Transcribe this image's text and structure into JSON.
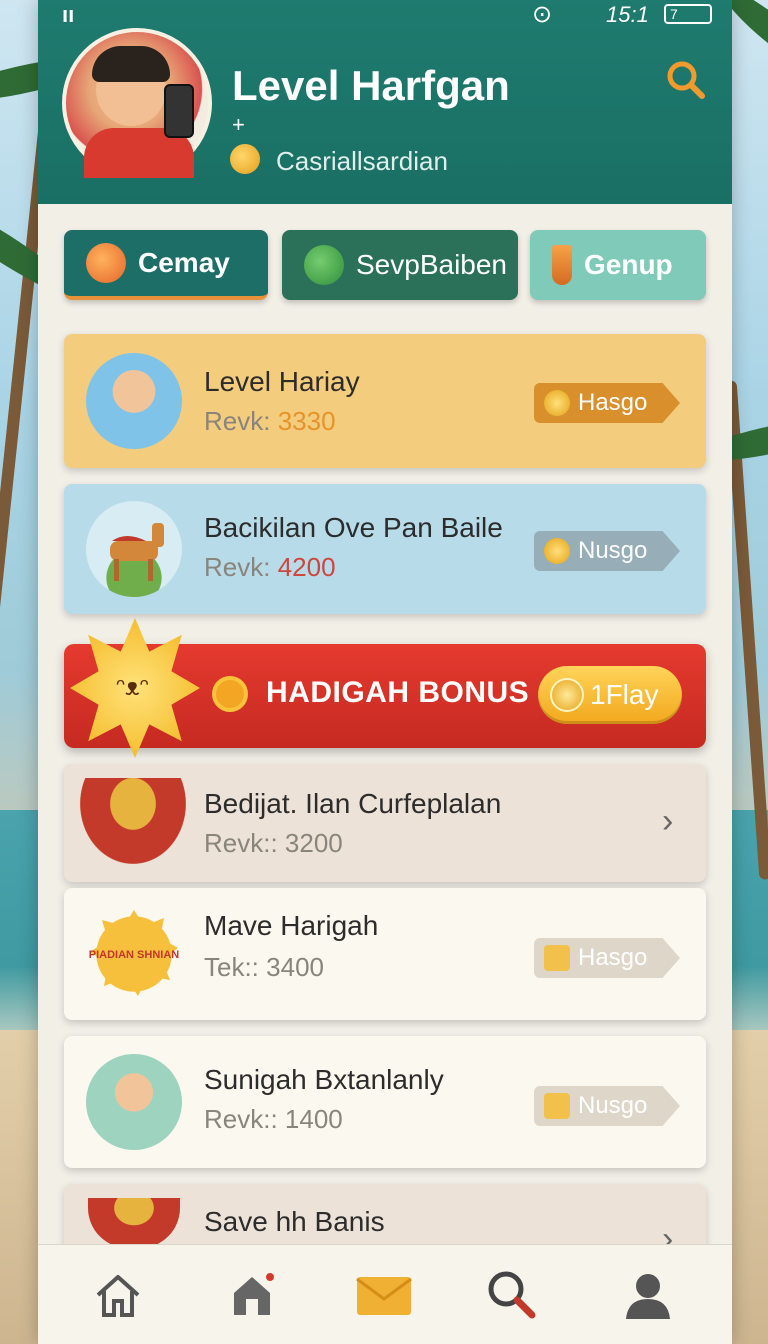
{
  "status_bar": {
    "signal": "ıı",
    "alarm": "⊙",
    "time": "15:1",
    "battery": "7"
  },
  "header": {
    "title": "Level Harfgan",
    "plus": "+",
    "subtitle": "Casriallsardian"
  },
  "tabs": [
    {
      "label": "Cemay"
    },
    {
      "label": "SevpBaiben"
    },
    {
      "label": "Genup"
    }
  ],
  "items": [
    {
      "title": "Level Hariay",
      "meta_label": "Revk:",
      "meta_value": "3330",
      "meta_color": "#e6932a",
      "action": "Hasgo"
    },
    {
      "title": "Bacikilan Ove Pan Baile",
      "meta_label": "Revk:",
      "meta_value": "4200",
      "meta_color": "#d0463a",
      "action": "Nusgo"
    },
    {
      "title": "Bedijat. Ilan Curfeplalan",
      "meta_label": "Revk::",
      "meta_value": "3200",
      "meta_color": "#8a857c"
    },
    {
      "title": "Mave Harigah",
      "meta_label": "Tek::",
      "meta_value": "3400",
      "meta_color": "#8a857c",
      "action": "Hasgo",
      "thumb_text": "PIADIAN SHNIAN"
    },
    {
      "title": "Sunigah Bxtanlanly",
      "meta_label": "Revk::",
      "meta_value": "1400",
      "meta_color": "#8a857c",
      "action": "Nusgo"
    },
    {
      "title": "Save hh Banis"
    }
  ],
  "bonus": {
    "title": "HADIGAH BONUS",
    "button": "1Flay"
  },
  "nav": [
    "home-icon",
    "store-icon",
    "mail-icon",
    "search-icon",
    "profile-icon"
  ],
  "colors": {
    "header": "#1f7b6f",
    "accent": "#e79239",
    "bonus": "#e53a2f"
  }
}
